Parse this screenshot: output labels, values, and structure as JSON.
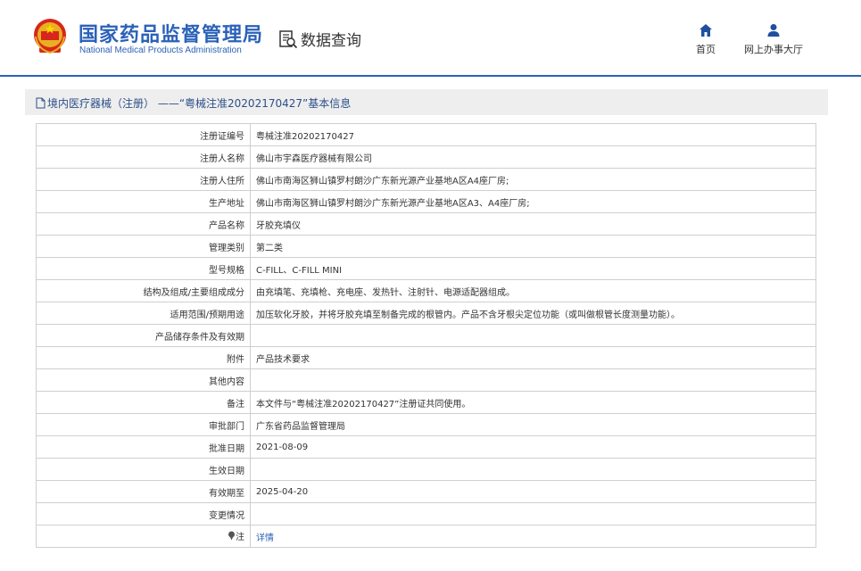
{
  "header": {
    "brand_cn": "国家药品监督管理局",
    "brand_en": "National Medical Products Administration",
    "data_query": "数据查询",
    "nav": {
      "home": "首页",
      "online_hall": "网上办事大厅"
    }
  },
  "panel": {
    "title": "境内医疗器械（注册） ——“粤械注准20202170427”基本信息"
  },
  "rows": [
    {
      "label": "注册证编号",
      "value": "粤械注准20202170427"
    },
    {
      "label": "注册人名称",
      "value": "佛山市宇森医疗器械有限公司"
    },
    {
      "label": "注册人住所",
      "value": "佛山市南海区狮山镇罗村朗沙广东新光源产业基地A区A4座厂房;"
    },
    {
      "label": "生产地址",
      "value": "佛山市南海区狮山镇罗村朗沙广东新光源产业基地A区A3、A4座厂房;"
    },
    {
      "label": "产品名称",
      "value": "牙胶充填仪"
    },
    {
      "label": "管理类别",
      "value": "第二类"
    },
    {
      "label": "型号规格",
      "value": "C-FILL、C-FILL MINI"
    },
    {
      "label": "结构及组成/主要组成成分",
      "value": "由充填笔、充填枪、充电座、发热针、注射针、电源适配器组成。"
    },
    {
      "label": "适用范围/预期用途",
      "value": "加压软化牙胶，并将牙胶充填至制备完成的根管内。产品不含牙根尖定位功能（或叫做根管长度测量功能）。"
    },
    {
      "label": "产品储存条件及有效期",
      "value": ""
    },
    {
      "label": "附件",
      "value": "产品技术要求"
    },
    {
      "label": "其他内容",
      "value": ""
    },
    {
      "label": "备注",
      "value": "本文件与“粤械注准20202170427”注册证共同使用。"
    },
    {
      "label": "审批部门",
      "value": "广东省药品监督管理局"
    },
    {
      "label": "批准日期",
      "value": "2021-08-09"
    },
    {
      "label": "生效日期",
      "value": ""
    },
    {
      "label": "有效期至",
      "value": "2025-04-20"
    },
    {
      "label": "变更情况",
      "value": ""
    }
  ],
  "note_row": {
    "label": "注",
    "link": "详情"
  },
  "colors": {
    "brand_blue": "#2b62b8",
    "border": "#cfcfcf",
    "panel_bg": "#eeeeee"
  }
}
